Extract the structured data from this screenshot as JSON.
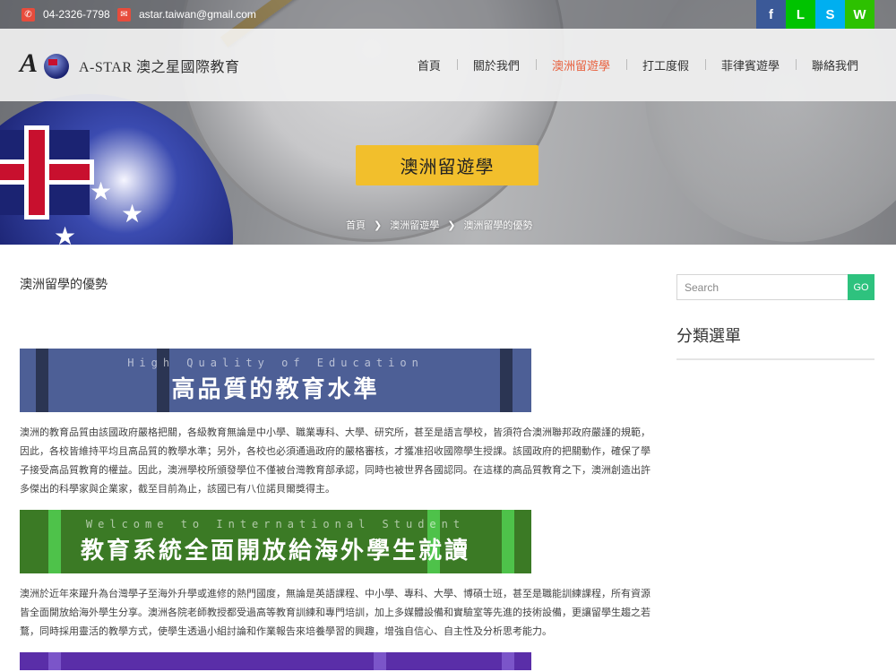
{
  "topbar": {
    "phone": "04-2326-7798",
    "email": "astar.taiwan@gmail.com",
    "social": [
      {
        "icon": "facebook-icon",
        "glyph": "f",
        "color": "#3b5998"
      },
      {
        "icon": "line-icon",
        "glyph": "L",
        "color": "#00c300"
      },
      {
        "icon": "skype-icon",
        "glyph": "S",
        "color": "#00aff0"
      },
      {
        "icon": "wechat-icon",
        "glyph": "W",
        "color": "#2dc100"
      }
    ]
  },
  "brand": {
    "logo_letter": "A",
    "name": "A-STAR 澳之星國際教育"
  },
  "nav": {
    "items": [
      "首頁",
      "關於我們",
      "澳洲留遊學",
      "打工度假",
      "菲律賓遊學",
      "聯絡我們"
    ],
    "active_index": 2,
    "active_color": "#e8613f"
  },
  "hero": {
    "title": "澳洲留遊學",
    "breadcrumb": [
      "首頁",
      "澳洲留遊學",
      "澳洲留學的優勢"
    ],
    "separator": "❯"
  },
  "post": {
    "title": "澳洲留學的優勢",
    "banner1": {
      "en": "High Quality of Education",
      "zh": "高品質的教育水準"
    },
    "para1": "澳洲的教育品質由該國政府嚴格把關，各級教育無論是中小學、職業專科、大學、研究所，甚至是語言學校，皆須符合澳洲聯邦政府嚴謹的規範，因此，各校皆維持平均且高品質的教學水準；另外，各校也必須通過政府的嚴格審核，才獲准招收國際學生授課。該國政府的把關動作，確保了學子接受高品質教育的權益。因此，澳洲學校所頒發學位不僅被台灣教育部承認，同時也被世界各國認同。在這樣的高品質教育之下，澳洲創造出許多傑出的科學家與企業家，截至目前為止，該國已有八位諾貝爾獎得主。",
    "banner2": {
      "en": "Welcome to International Student",
      "zh": "教育系統全面開放給海外學生就讀"
    },
    "para2": "澳洲於近年來躍升為台灣學子至海外升學或進修的熱門國度，無論是英語課程、中小學、專科、大學、博碩士班，甚至是職能訓練課程，所有資源皆全面開放給海外學生分享。澳洲各院老師教授都受過高等教育訓練和專門培訓，加上多媒體設備和實驗室等先進的技術設備，更讓留學生趨之若鶩，同時採用靈活的教學方式，使學生透過小組討論和作業報告來培養學習的興趣，增強自信心、自主性及分析思考能力。"
  },
  "sidebar": {
    "search_placeholder": "Search",
    "go_label": "GO",
    "category_title": "分類選單"
  }
}
